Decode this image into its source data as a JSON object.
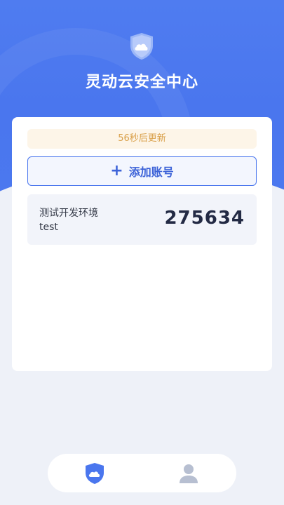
{
  "header": {
    "title": "灵动云安全中心",
    "logo_icon": "shield-cloud-icon"
  },
  "card": {
    "refresh_notice": "56秒后更新",
    "add_button_label": "添加账号",
    "add_button_icon": "plus-icon",
    "accounts": [
      {
        "name": "测试开发环境",
        "user": "test",
        "code": "275634"
      }
    ]
  },
  "tabbar": {
    "items": [
      {
        "icon": "shield-cloud-icon",
        "active": true
      },
      {
        "icon": "user-icon",
        "active": false
      }
    ]
  },
  "colors": {
    "primary": "#4a76ee",
    "notice_text": "#d9a04a",
    "notice_bg": "#fdf5e8"
  }
}
